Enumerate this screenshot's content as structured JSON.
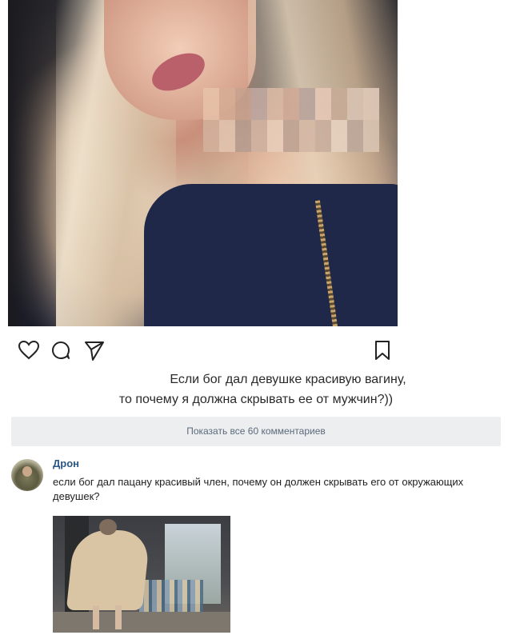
{
  "post": {
    "photo_alt": "",
    "caption_line1": "Если бог дал девушке красивую вагину,",
    "caption_line2": "то почему я должна скрывать ее от мужчин?))",
    "actions": {
      "like_icon": "heart-icon",
      "comment_icon": "comment-bubble-icon",
      "share_icon": "paper-plane-icon",
      "bookmark_icon": "bookmark-icon"
    }
  },
  "comments_section": {
    "show_all_label": "Показать все 60 комментариев"
  },
  "comment": {
    "author": "Дрон",
    "text": "если бог дал пацану красивый член, почему он должен скрывать его от окружающих девушек?"
  },
  "colors": {
    "link": "#2a5885",
    "show_comments_bg": "#edeef0",
    "show_comments_text": "#5b6a7c"
  }
}
